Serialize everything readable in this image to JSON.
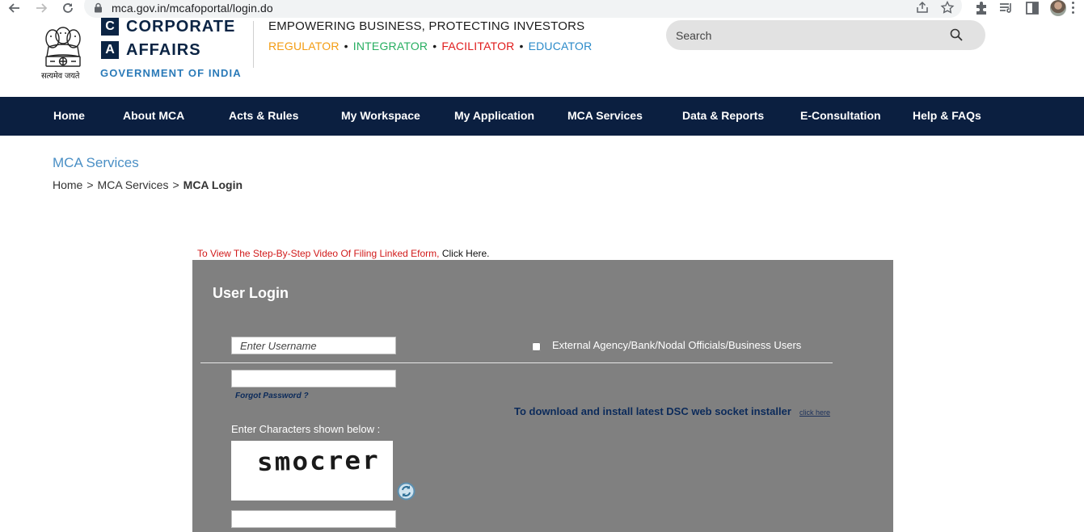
{
  "browser": {
    "url": "mca.gov.in/mcafoportal/login.do",
    "icons": [
      "back-arrow-icon",
      "forward-arrow-icon",
      "reload-icon",
      "lock-icon",
      "share-icon",
      "bookmark-star-icon",
      "extensions-puzzle-icon",
      "reading-list-icon",
      "side-panel-icon",
      "profile-avatar",
      "more-menu-icon"
    ]
  },
  "header": {
    "logo": {
      "box1": "C",
      "word1": "CORPORATE",
      "box2": "A",
      "word2": "AFFAIRS",
      "government": "GOVERNMENT OF INDIA",
      "emblem_caption": "सत्यमेव जयते"
    },
    "tagline": "EMPOWERING BUSINESS, PROTECTING INVESTORS",
    "roles": [
      {
        "label": "REGULATOR",
        "color": "#f39c12"
      },
      {
        "label": "INTEGRATOR",
        "color": "#27ae60"
      },
      {
        "label": "FACILITATOR",
        "color": "#e01b1b"
      },
      {
        "label": "EDUCATOR",
        "color": "#2a8ac9"
      }
    ],
    "role_separator": "•",
    "search": {
      "placeholder": "Search"
    }
  },
  "nav": {
    "items": [
      "Home",
      "About MCA",
      "Acts & Rules",
      "My Workspace",
      "My Application",
      "MCA Services",
      "Data & Reports",
      "E-Consultation",
      "Help & FAQs"
    ]
  },
  "page": {
    "title": "MCA Services",
    "breadcrumb": [
      "Home",
      "MCA Services",
      "MCA Login"
    ],
    "breadcrumb_sep": ">"
  },
  "notice": {
    "text": "To View The Step-By-Step Video Of Filing Linked Eform,",
    "link": "Click Here."
  },
  "login": {
    "title": "User Login",
    "username_placeholder": "Enter Username",
    "external_label": "External Agency/Bank/Nodal Officials/Business Users",
    "forgot_password": "Forgot Password ?",
    "dsc_text": "To download and install latest DSC web socket installer",
    "dsc_link": "click here",
    "captcha_label": "Enter Characters shown below :",
    "captcha_text": "smocrer"
  },
  "colors": {
    "nav_bg": "#0b1f40",
    "panel_bg": "#808080",
    "brand_navy": "#0b2444",
    "link_blue": "#2a7ab8"
  }
}
